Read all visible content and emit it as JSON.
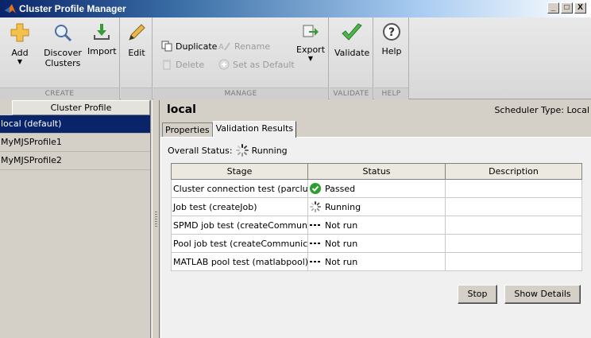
{
  "window": {
    "title": "Cluster Profile Manager",
    "buttons": [
      "_",
      "□",
      "X"
    ]
  },
  "toolstrip": {
    "create": {
      "label": "CREATE",
      "add": "Add",
      "discover_line1": "Discover",
      "discover_line2": "Clusters",
      "import": "Import"
    },
    "edit_label": "Edit",
    "manage": {
      "label": "MANAGE",
      "duplicate": "Duplicate",
      "rename": "Rename",
      "delete": "Delete",
      "set_default": "Set as Default",
      "export": "Export"
    },
    "validate": {
      "label": "VALIDATE",
      "validate": "Validate"
    },
    "help": {
      "label": "HELP",
      "help": "Help"
    }
  },
  "profiles": {
    "header": "Cluster Profile",
    "items": [
      "local (default)",
      "MyMJSProfile1",
      "MyMJSProfile2"
    ],
    "selected_index": 0
  },
  "main": {
    "profile_name": "local",
    "scheduler_type": "Scheduler Type: Local",
    "tabs": [
      "Properties",
      "Validation Results"
    ],
    "active_tab": 1,
    "overall_label": "Overall Status:",
    "overall_status": "Running"
  },
  "table": {
    "columns": [
      "Stage",
      "Status",
      "Description"
    ],
    "rows": [
      {
        "stage": "Cluster connection test (parclust...",
        "status": "Passed",
        "icon": "check-icon",
        "description": ""
      },
      {
        "stage": "Job test (createJob)",
        "status": "Running",
        "icon": "spinner-icon",
        "description": ""
      },
      {
        "stage": "SPMD job test (createCommunic...",
        "status": "Not run",
        "icon": "dashes-icon",
        "description": ""
      },
      {
        "stage": "Pool job test (createCommunicat...",
        "status": "Not run",
        "icon": "dashes-icon",
        "description": ""
      },
      {
        "stage": "MATLAB pool test (matlabpool)",
        "status": "Not run",
        "icon": "dashes-icon",
        "description": ""
      }
    ]
  },
  "actions": {
    "stop": "Stop",
    "show_details": "Show Details"
  },
  "colors": {
    "selection": "#0a246a",
    "passed": "#2e9e2e",
    "titlebar": "#0a246a"
  }
}
